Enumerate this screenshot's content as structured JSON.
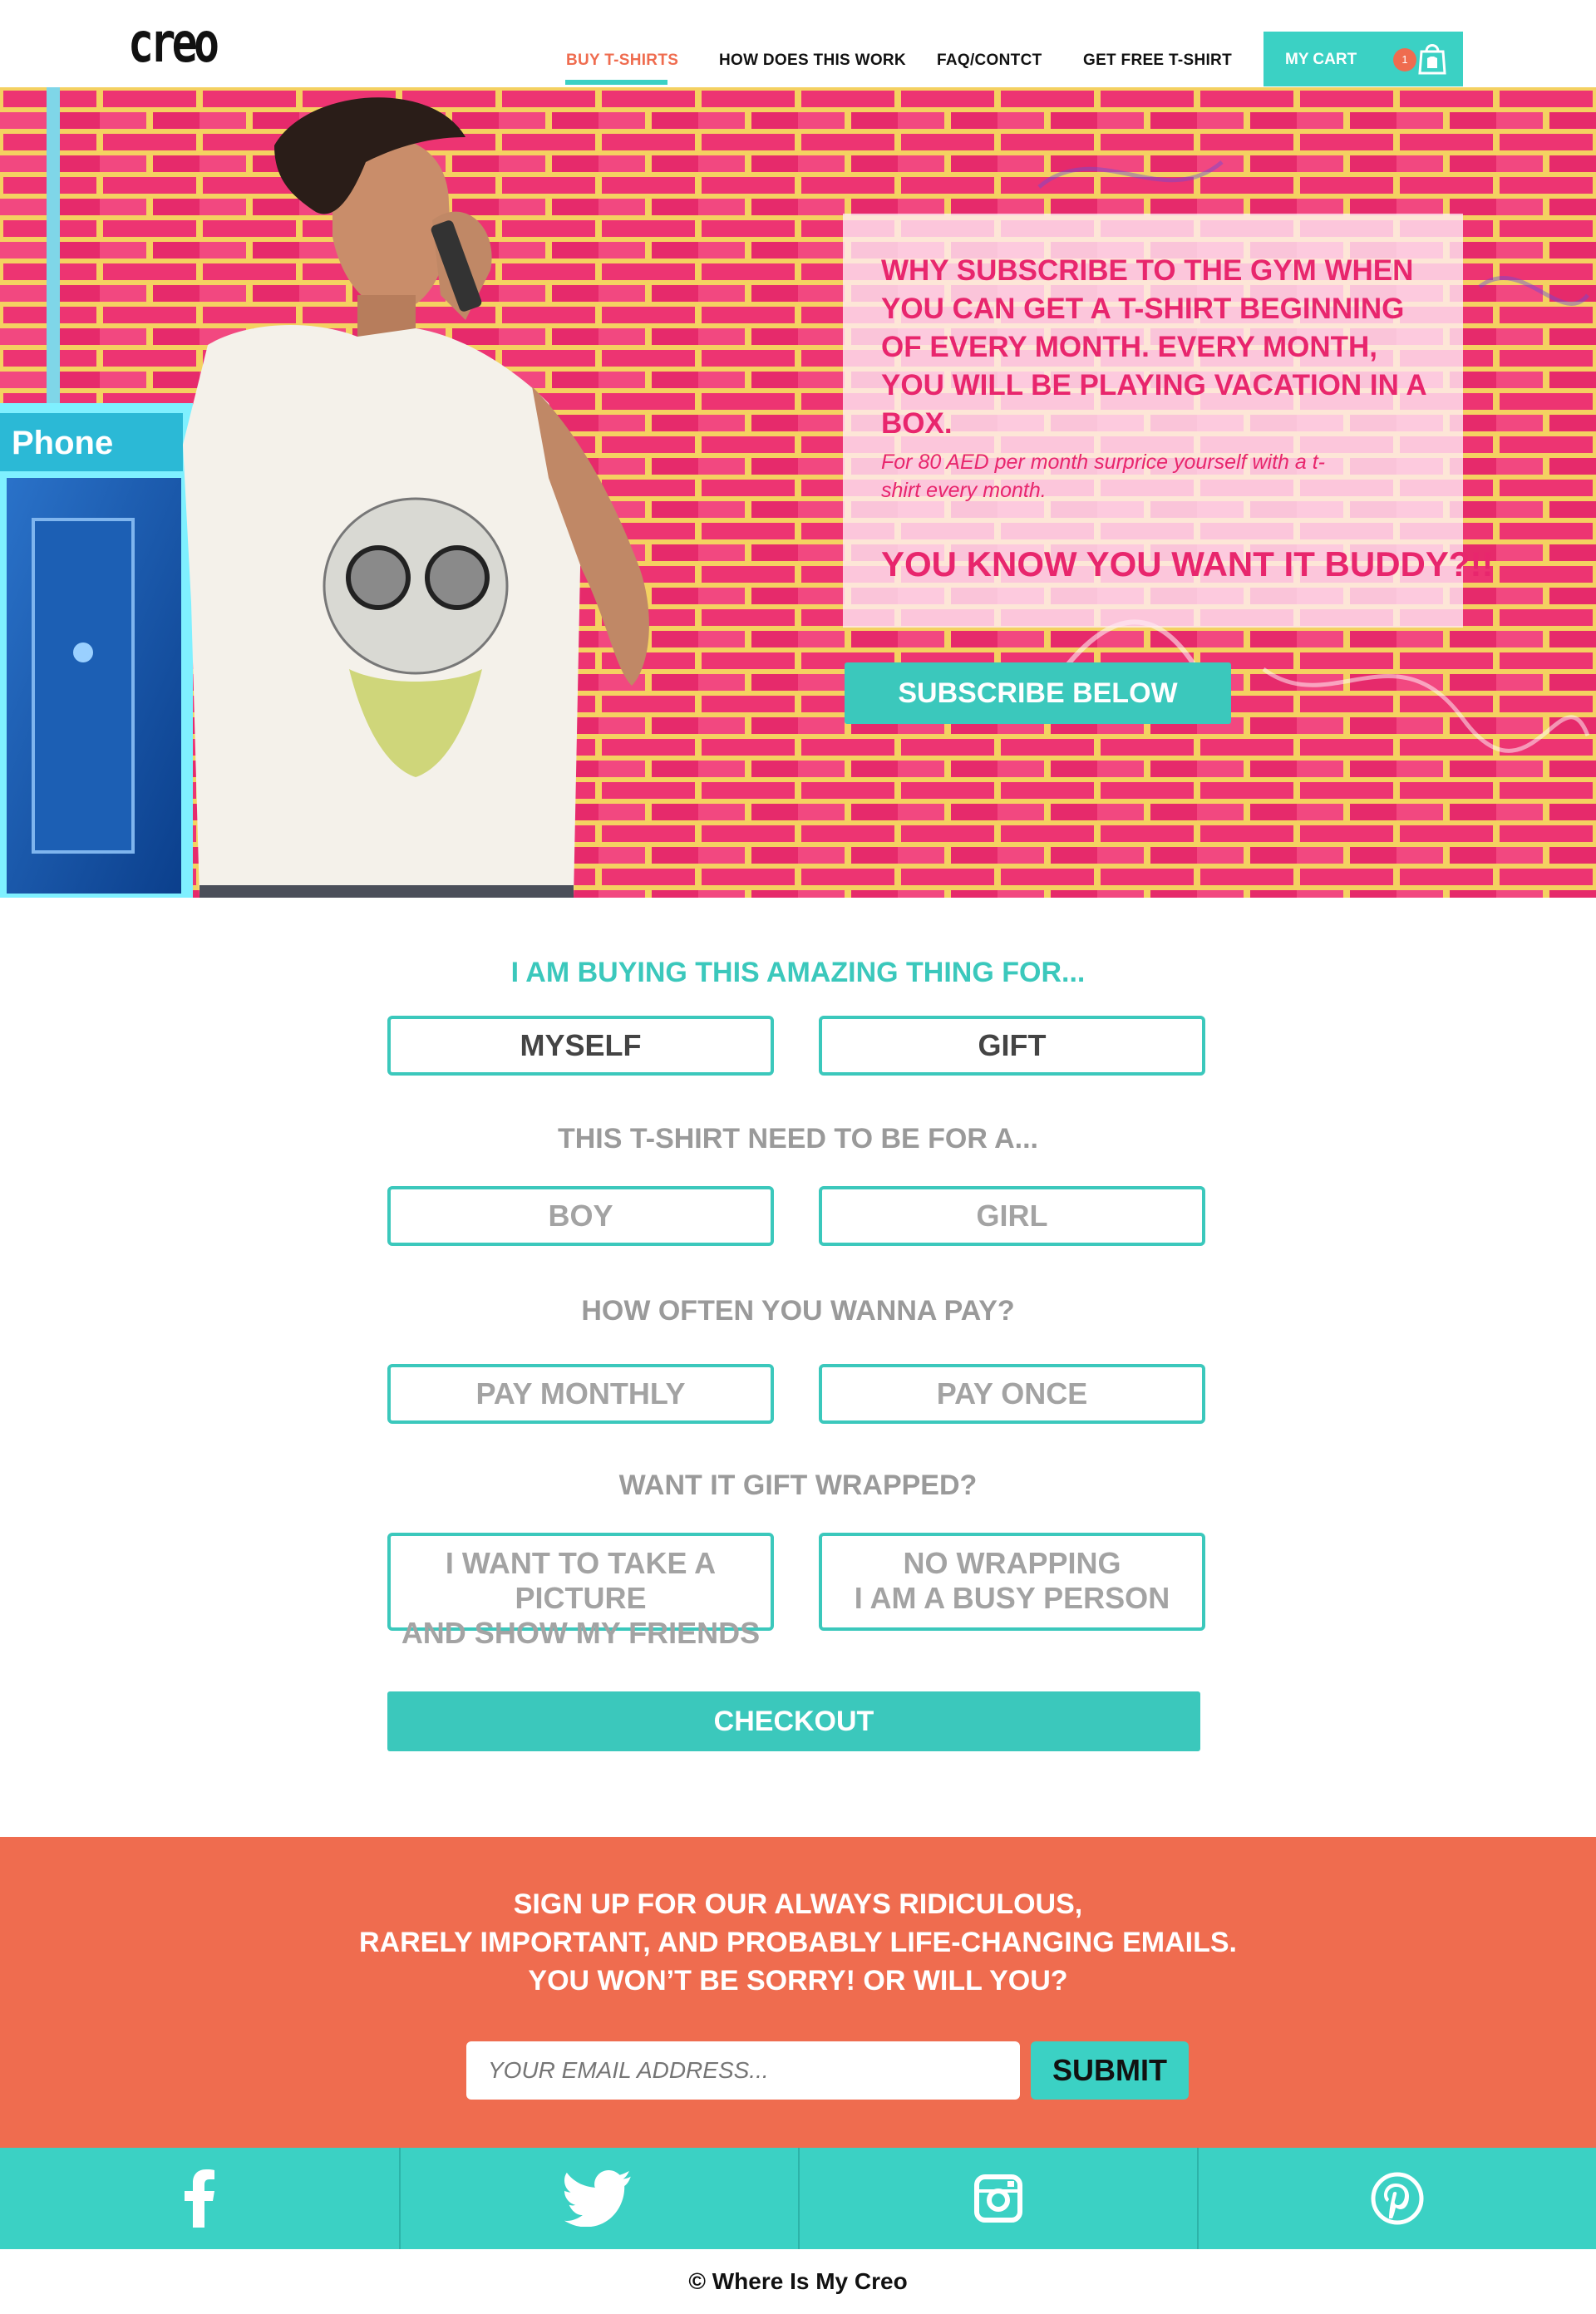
{
  "header": {
    "logo": "creo",
    "nav": [
      {
        "label": "BUY T-SHIRTS",
        "active": true
      },
      {
        "label": "HOW DOES THIS WORK",
        "active": false
      },
      {
        "label": "FAQ/CONTCT",
        "active": false
      },
      {
        "label": "GET FREE T-SHIRT",
        "active": false
      }
    ],
    "cart": {
      "label": "MY CART",
      "count": "1",
      "icon": "shopping-bag-icon"
    }
  },
  "hero": {
    "headline": "WHY SUBSCRIBE TO THE GYM WHEN YOU CAN GET A T-SHIRT BEGINNING OF EVERY MONTH. EVERY MONTH, YOU WILL BE PLAYING VACATION IN A BOX.",
    "subtext": "For 80 AED per month surprice yourself with a t-shirt every month.",
    "cta_text": "YOU KNOW YOU WANT IT BUDDY?!!",
    "subscribe_button": "SUBSCRIBE BELOW",
    "phone_sign": "Phone"
  },
  "form": {
    "q1": {
      "label": "I AM BUYING THIS AMAZING THING FOR...",
      "options": [
        "MYSELF",
        "GIFT"
      ]
    },
    "q2": {
      "label": "THIS T-SHIRT NEED TO BE FOR A...",
      "options": [
        "BOY",
        "GIRL"
      ]
    },
    "q3": {
      "label": "HOW OFTEN YOU WANNA PAY?",
      "options": [
        "PAY MONTHLY",
        "PAY ONCE"
      ]
    },
    "q4": {
      "label": "WANT IT GIFT WRAPPED?",
      "options": [
        "I WANT TO TAKE A PICTURE\nAND SHOW MY FRIENDS",
        "NO WRAPPING\nI AM A BUSY PERSON"
      ]
    },
    "checkout_button": "CHECKOUT"
  },
  "newsletter": {
    "lines": [
      "SIGN UP FOR OUR ALWAYS RIDICULOUS,",
      "RARELY IMPORTANT, AND PROBABLY LIFE-CHANGING EMAILS.",
      "YOU WON’T BE SORRY! OR WILL YOU?"
    ],
    "email_placeholder": "YOUR EMAIL ADDRESS...",
    "submit_button": "SUBMIT"
  },
  "social": [
    {
      "name": "facebook-icon"
    },
    {
      "name": "twitter-icon"
    },
    {
      "name": "instagram-icon"
    },
    {
      "name": "pinterest-icon"
    }
  ],
  "footer": {
    "copyright": "© Where Is My Creo"
  },
  "colors": {
    "accent": "#3bc8bc",
    "coral": "#ef6c4f",
    "pink": "#e8266d"
  }
}
